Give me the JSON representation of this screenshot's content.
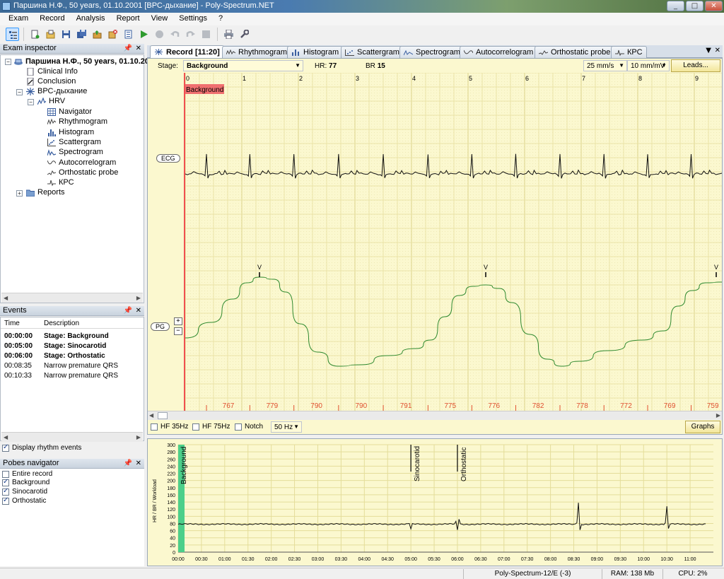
{
  "window": {
    "title": "Паршина Н.Ф., 50 years, 01.10.2001 [ВРС-дыхание] - Poly-Spectrum.NET",
    "controls": [
      "_",
      "□",
      "✕"
    ]
  },
  "menu": [
    "Exam",
    "Record",
    "Analysis",
    "Report",
    "View",
    "Settings",
    "?"
  ],
  "toolbar": {
    "icons": [
      "exam-inspector-icon",
      "new-exam-icon",
      "open-exam-icon",
      "save-icon",
      "save-all-icon",
      "export-icon",
      "delete-icon",
      "properties-icon",
      "play-icon",
      "record-icon",
      "undo-icon",
      "redo-icon",
      "stop-icon",
      "print-icon",
      "tools-icon"
    ],
    "colors": {
      "play": "#2e9b2e",
      "disabled": "#b8bcc2"
    }
  },
  "exam_inspector": {
    "title": "Exam inspector",
    "patient": "Паршина Н.Ф., 50 years, 01.10.2001",
    "clinical_info": "Clinical Info",
    "conclusion": "Conclusion",
    "study": "ВРС-дыхание",
    "hrv": "HRV",
    "hrv_items": [
      "Navigator",
      "Rhythmogram",
      "Histogram",
      "Scattergram",
      "Spectrogram",
      "Autocorrelogram",
      "Orthostatic probe",
      "КРС"
    ],
    "reports": "Reports"
  },
  "events": {
    "title": "Events",
    "col_time": "Time",
    "col_desc": "Description",
    "rows": [
      {
        "time": "00:00:00",
        "desc": "Stage: Background",
        "bold": true
      },
      {
        "time": "00:05:00",
        "desc": "Stage: Sinocarotid",
        "bold": true
      },
      {
        "time": "00:06:00",
        "desc": "Stage: Orthostatic",
        "bold": true
      },
      {
        "time": "00:08:35",
        "desc": "Narrow premature QRS",
        "bold": false
      },
      {
        "time": "00:10:33",
        "desc": "Narrow premature QRS",
        "bold": false
      }
    ],
    "display_rhythm": "Display rhythm events",
    "display_rhythm_checked": true
  },
  "probes_navigator": {
    "title": "Pobes navigator",
    "items": [
      {
        "label": "Entire record",
        "checked": false
      },
      {
        "label": "Background",
        "checked": true
      },
      {
        "label": "Sinocarotid",
        "checked": true
      },
      {
        "label": "Orthostatic",
        "checked": true
      }
    ]
  },
  "tabs": [
    "Record [11:20]",
    "Rhythmogram",
    "Histogram",
    "Scattergram",
    "Spectrogram",
    "Autocorrelogram",
    "Orthostatic probe",
    "КРС"
  ],
  "record": {
    "stage_label": "Stage:",
    "stage_value": "Background",
    "hr_label": "HR:",
    "hr_value": "77",
    "br_label": "BR",
    "br_value": "15",
    "speed": "25 mm/s",
    "gain": "10 mm/mV",
    "leads_button": "Leads...",
    "seconds": [
      "0",
      "1",
      "2",
      "3",
      "4",
      "5",
      "6",
      "7",
      "8",
      "9"
    ],
    "stage_tag": "Background",
    "ecg_label": "ECG",
    "pg_label": "PG",
    "plus": "+",
    "minus": "−",
    "rr_intervals": [
      "767",
      "779",
      "790",
      "790",
      "791",
      "775",
      "776",
      "782",
      "778",
      "772",
      "769",
      "759"
    ],
    "peak_marks": [
      "V",
      "V",
      "V"
    ],
    "colors": {
      "grid_bg": "#fbf8cf",
      "grid_line": "#e4dd9a",
      "ecg": "#111111",
      "pg": "#2f8a2f",
      "cursor": "#f05050",
      "rr": "#e05030"
    }
  },
  "filters": {
    "hf35": "HF 35Hz",
    "hf35_checked": false,
    "hf75": "HF 75Hz",
    "hf75_checked": false,
    "notch": "Notch",
    "notch_checked": false,
    "mains": "50 Hz",
    "graphs_button": "Graphs"
  },
  "trend": {
    "ylabel": "HR / BR / Workload",
    "y_ticks": [
      "300",
      "280",
      "260",
      "240",
      "220",
      "200",
      "180",
      "160",
      "140",
      "120",
      "100",
      "80",
      "60",
      "40",
      "20",
      "0"
    ],
    "x_ticks": [
      "00:00",
      "00:30",
      "01:00",
      "01:30",
      "02:00",
      "02:30",
      "03:00",
      "03:30",
      "04:00",
      "04:30",
      "05:00",
      "05:30",
      "06:00",
      "06:30",
      "07:00",
      "07:30",
      "08:00",
      "08:30",
      "09:00",
      "09:30",
      "10:00",
      "10:30",
      "11:00"
    ],
    "stage_marks": [
      {
        "label": "Background",
        "t_sec": 0
      },
      {
        "label": "Sinocarotid",
        "t_sec": 300
      },
      {
        "label": "Orthostatic",
        "t_sec": 360
      }
    ]
  },
  "status": {
    "device": "Poly-Spectrum-12/E (-3)",
    "ram": "RAM: 138 Mb",
    "cpu": "CPU: 2%"
  }
}
